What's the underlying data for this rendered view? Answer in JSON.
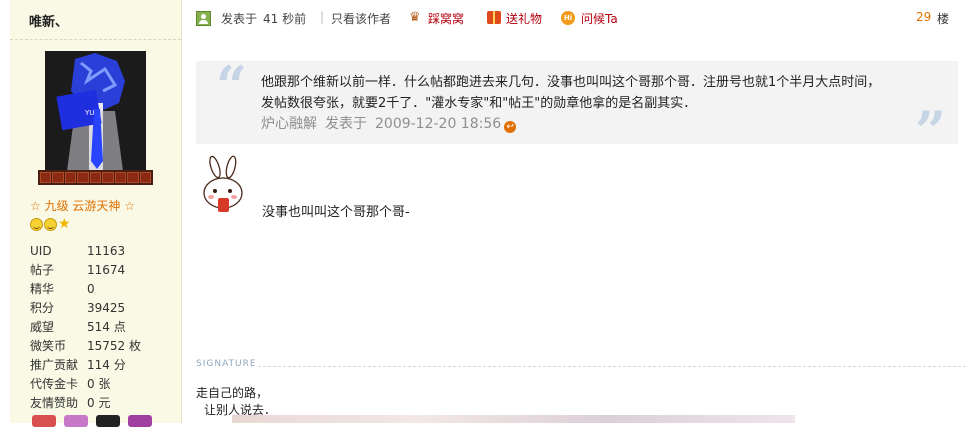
{
  "user": {
    "name": "唯新、",
    "rank": "☆ 九级  云游天神 ☆",
    "stats": [
      {
        "label": "UID",
        "value": "11163"
      },
      {
        "label": "帖子",
        "value": "11674"
      },
      {
        "label": "精华",
        "value": "0"
      },
      {
        "label": "积分",
        "value": "39425"
      },
      {
        "label": "威望",
        "value": "514 点"
      },
      {
        "label": "微笑币",
        "value": "15752 枚"
      },
      {
        "label": "推广贡献",
        "value": "114 分"
      },
      {
        "label": "代传金卡",
        "value": "0 张"
      },
      {
        "label": "友情赞助",
        "value": "0 元"
      }
    ]
  },
  "post": {
    "posted_prefix": "发表于",
    "posted_time": "41 秒前",
    "pipe": "|",
    "only_author": "只看该作者",
    "actions": {
      "visit": "踩窝窝",
      "gift": "送礼物",
      "greet": "问候Ta",
      "greet_icon": "Hi"
    },
    "floor": "29",
    "floor_unit": "楼"
  },
  "quote": {
    "text": "他跟那个维新以前一样．什么帖都跑进去来几句．没事也叫叫这个哥那个哥．注册号也就1个半月大点时间，发帖数很夸张，就要2千了．\"灌水专家\"和\"帖王\"的勋章他拿的是名副其实．",
    "author": "炉心融解",
    "posted_label": "发表于",
    "date": "2009-12-20 18:56",
    "open_mark": "“",
    "close_mark": "”"
  },
  "reply": {
    "text": "没事也叫叫这个哥那个哥-"
  },
  "signature": {
    "header": "SIGNATURE",
    "line1": "走自己的路，",
    "line2": "让别人说去．"
  },
  "colors": {
    "sidebar_bg": "#f9f9e6",
    "link_red": "#b4000e",
    "accent_orange": "#e07000",
    "quote_bg": "#f3f3f3",
    "quote_mark": "#c6d5e6"
  },
  "icons": {
    "user": "user-icon",
    "visit": "footprint-icon",
    "gift": "gift-icon",
    "greet": "hi-icon",
    "back": "back-arrow-icon"
  }
}
